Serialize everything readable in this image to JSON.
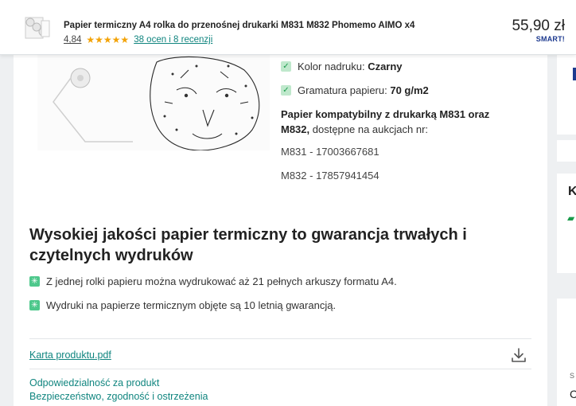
{
  "header": {
    "title": "Papier termiczny A4 rolka do przenośnej drukarki M831 M832 Phomemo AIMO x4",
    "rating_value": "4,84",
    "stars": "★★★★★",
    "rating_link": "38 ocen i 8 recenzji",
    "price": "55,90 zł",
    "smart_badge": "SMART!"
  },
  "specs": [
    {
      "label": "Kolor nadruku:",
      "value": "Czarny"
    },
    {
      "label": "Gramatura papieru:",
      "value": "70 g/m2"
    }
  ],
  "compat": {
    "bold": "Papier kompatybilny z drukarką M831 oraz M832,",
    "rest": " dostępne na aukcjach nr:"
  },
  "codes": [
    "M831 - 17003667681",
    "M832 - 17857941454"
  ],
  "section": {
    "title": "Wysokiej jakości papier termiczny to gwarancja trwałych i czytelnych wydruków",
    "bullets": [
      "Z jednej rolki papieru można wydrukować aż 21 pełnych arkuszy formatu A4.",
      "Wydruki na papierze termicznym objęte są 10 letnią gwarancją."
    ]
  },
  "file_link": "Karta produktu.pdf",
  "footer_links": [
    "Odpowiedzialność za produkt",
    "Bezpieczeństwo, zgodność i ostrzeżenia"
  ],
  "right_col": {
    "heading_letter": "K",
    "small_letter": "S",
    "letter": "C"
  },
  "icons": {
    "check": "check-icon",
    "sparkle": "sparkle-icon",
    "download": "download-icon"
  },
  "colors": {
    "link": "#10857f",
    "star": "#f3a307",
    "accent_green": "#4ec88c"
  }
}
